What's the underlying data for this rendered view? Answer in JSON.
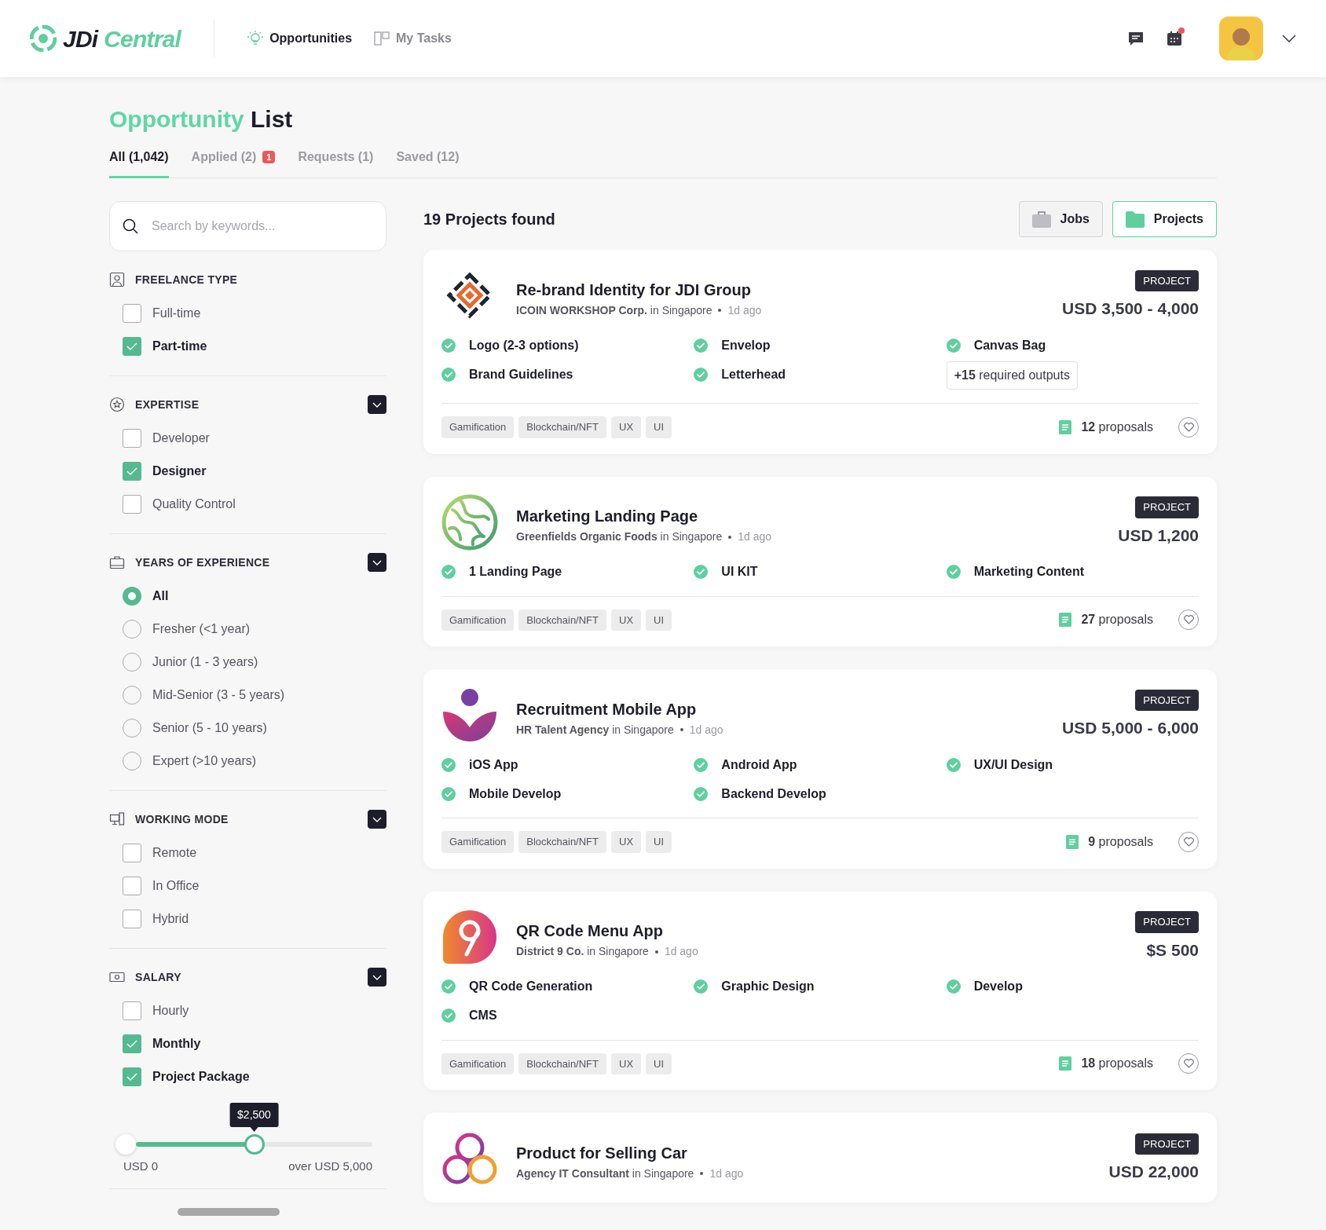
{
  "header": {
    "logo": {
      "first": "JDi",
      "second": "Central"
    },
    "nav": [
      {
        "label": "Opportunities",
        "selected": true
      },
      {
        "label": "My Tasks",
        "selected": false
      }
    ],
    "notifications": {
      "calendar_dot": true
    }
  },
  "page_title": {
    "accent": "Opportunity",
    "rest": "List"
  },
  "tabs": [
    {
      "label": "All (1,042)",
      "selected": true
    },
    {
      "label": "Applied (2)",
      "selected": false,
      "badge": "1"
    },
    {
      "label": "Requests (1)",
      "selected": false
    },
    {
      "label": "Saved (12)",
      "selected": false
    }
  ],
  "search": {
    "placeholder": "Search by keywords..."
  },
  "filters": [
    {
      "title": "FREELANCE TYPE",
      "collapsible": false,
      "kind": "checkbox",
      "options": [
        {
          "label": "Full-time",
          "checked": false
        },
        {
          "label": "Part-time",
          "checked": true
        }
      ]
    },
    {
      "title": "EXPERTISE",
      "collapsible": true,
      "kind": "checkbox",
      "options": [
        {
          "label": "Developer",
          "checked": false
        },
        {
          "label": "Designer",
          "checked": true
        },
        {
          "label": "Quality Control",
          "checked": false
        }
      ]
    },
    {
      "title": "YEARS OF EXPERIENCE",
      "collapsible": true,
      "kind": "radio",
      "options": [
        {
          "label": "All",
          "selected": true
        },
        {
          "label": "Fresher (<1 year)",
          "selected": false
        },
        {
          "label": "Junior (1 - 3 years)",
          "selected": false
        },
        {
          "label": "Mid-Senior (3 - 5 years)",
          "selected": false
        },
        {
          "label": "Senior (5 - 10 years)",
          "selected": false
        },
        {
          "label": "Expert (>10 years)",
          "selected": false
        }
      ]
    },
    {
      "title": "WORKING MODE",
      "collapsible": true,
      "kind": "checkbox",
      "options": [
        {
          "label": "Remote",
          "checked": false
        },
        {
          "label": "In Office",
          "checked": false
        },
        {
          "label": "Hybrid",
          "checked": false
        }
      ]
    },
    {
      "title": "SALARY",
      "collapsible": true,
      "kind": "checkbox",
      "options": [
        {
          "label": "Hourly",
          "checked": false
        },
        {
          "label": "Monthly",
          "checked": true
        },
        {
          "label": "Project Package",
          "checked": true
        }
      ],
      "slider": {
        "level": 0.5,
        "tooltip": "$2,500",
        "min_label": "USD 0",
        "max_label": "over USD 5,000"
      }
    }
  ],
  "results": {
    "count": "19 Projects found",
    "view_toggle": [
      {
        "label": "Jobs",
        "selected": false
      },
      {
        "label": "Projects",
        "selected": true
      }
    ]
  },
  "projects": [
    {
      "title": "Re-brand Identity for JDI Group",
      "company": "**ICOIN WORKSHOP Corp.** in Singapore",
      "posted": "1d ago",
      "badge": "PROJECT",
      "price": "USD 3,500 - 4,000",
      "deliverables": [
        "Logo (2-3 options)",
        "Envelop",
        "Canvas Bag",
        "Brand Guidelines",
        "Letterhead"
      ],
      "more_outputs": "**+15** required outputs",
      "tags": [
        "Gamification",
        "Blockchain/NFT",
        "UX",
        "UI"
      ],
      "proposals": "**12** proposals"
    },
    {
      "title": "Marketing Landing Page",
      "company": "**Greenfields Organic Foods** in Singapore",
      "posted": "1d ago",
      "badge": "PROJECT",
      "price": "USD 1,200",
      "deliverables": [
        "1 Landing Page",
        "UI KIT",
        "Marketing Content"
      ],
      "tags": [
        "Gamification",
        "Blockchain/NFT",
        "UX",
        "UI"
      ],
      "proposals": "**27** proposals"
    },
    {
      "title": "Recruitment Mobile App",
      "company": "**HR Talent Agency** in Singapore",
      "posted": "1d ago",
      "badge": "PROJECT",
      "price": "USD 5,000 - 6,000",
      "deliverables": [
        "iOS App",
        "Android App",
        "UX/UI Design",
        "Mobile Develop",
        "Backend Develop"
      ],
      "tags": [
        "Gamification",
        "Blockchain/NFT",
        "UX",
        "UI"
      ],
      "proposals": "**9** proposals"
    },
    {
      "title": "QR Code Menu App",
      "company": "**District 9 Co.** in Singapore",
      "posted": "1d ago",
      "badge": "PROJECT",
      "price": "$S 500",
      "deliverables": [
        "QR Code Generation",
        "Graphic Design",
        "Develop",
        "CMS"
      ],
      "tags": [
        "Gamification",
        "Blockchain/NFT",
        "UX",
        "UI"
      ],
      "proposals": "**18** proposals"
    },
    {
      "title": "Product for Selling Car",
      "company": "**Agency IT Consultant** in Singapore",
      "posted": "1d ago",
      "badge": "PROJECT",
      "price": "USD 22,000"
    }
  ]
}
